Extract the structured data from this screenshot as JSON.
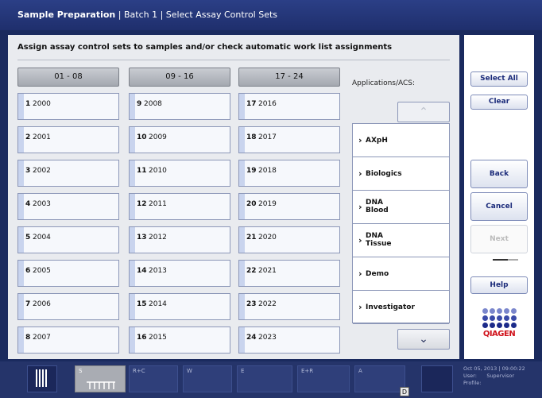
{
  "header": {
    "module": "Sample Preparation",
    "sep1": " | ",
    "batch": "Batch 1",
    "sep2": " | ",
    "step": "Select Assay Control Sets"
  },
  "main": {
    "instruction": "Assign assay control sets to samples and/or check automatic work list assignments"
  },
  "tabs": [
    "01 - 08",
    "09 - 16",
    "17 - 24"
  ],
  "samples": [
    {
      "n": "1",
      "v": "2000"
    },
    {
      "n": "2",
      "v": "2001"
    },
    {
      "n": "3",
      "v": "2002"
    },
    {
      "n": "4",
      "v": "2003"
    },
    {
      "n": "5",
      "v": "2004"
    },
    {
      "n": "6",
      "v": "2005"
    },
    {
      "n": "7",
      "v": "2006"
    },
    {
      "n": "8",
      "v": "2007"
    },
    {
      "n": "9",
      "v": "2008"
    },
    {
      "n": "10",
      "v": "2009"
    },
    {
      "n": "11",
      "v": "2010"
    },
    {
      "n": "12",
      "v": "2011"
    },
    {
      "n": "13",
      "v": "2012"
    },
    {
      "n": "14",
      "v": "2013"
    },
    {
      "n": "15",
      "v": "2014"
    },
    {
      "n": "16",
      "v": "2015"
    },
    {
      "n": "17",
      "v": "2016"
    },
    {
      "n": "18",
      "v": "2017"
    },
    {
      "n": "19",
      "v": "2018"
    },
    {
      "n": "20",
      "v": "2019"
    },
    {
      "n": "21",
      "v": "2020"
    },
    {
      "n": "22",
      "v": "2021"
    },
    {
      "n": "23",
      "v": "2022"
    },
    {
      "n": "24",
      "v": "2023"
    }
  ],
  "acs": {
    "label": "Applications/ACS:",
    "items": [
      {
        "l1": "AXpH",
        "l2": ""
      },
      {
        "l1": "Biologics",
        "l2": ""
      },
      {
        "l1": "DNA",
        "l2": "Blood"
      },
      {
        "l1": "DNA",
        "l2": "Tissue"
      },
      {
        "l1": "Demo",
        "l2": ""
      },
      {
        "l1": "Investigator",
        "l2": ""
      }
    ],
    "chevron": "›",
    "scroll_up_icon": "⌃",
    "scroll_down_icon": "⌄"
  },
  "sidebar": {
    "select_all": "Select All",
    "clear": "Clear",
    "back": "Back",
    "cancel": "Cancel",
    "next": "Next",
    "help": "Help"
  },
  "logo": {
    "text": "QIAGEN",
    "dots_top": "#3a4aa8",
    "dots_bottom": "#1b2a8a"
  },
  "taskbar": {
    "slots": [
      "S",
      "R+C",
      "W",
      "E",
      "E+R",
      "A"
    ],
    "badge": "D",
    "status": {
      "datetime": "Oct 05, 2013 | 09:00:22",
      "user_label": "User:",
      "user": "Supervisor",
      "profile_label": "Profile:"
    }
  }
}
